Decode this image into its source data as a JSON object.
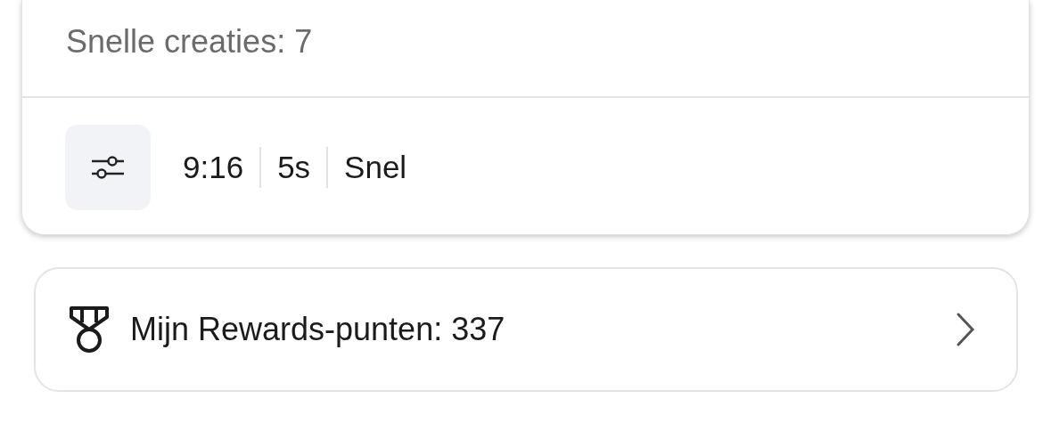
{
  "creation_card": {
    "quick_creations": "Snelle creaties: 7",
    "options": [
      "9:16",
      "5s",
      "Snel"
    ]
  },
  "rewards": {
    "label": "Mijn Rewards-punten: 337"
  }
}
